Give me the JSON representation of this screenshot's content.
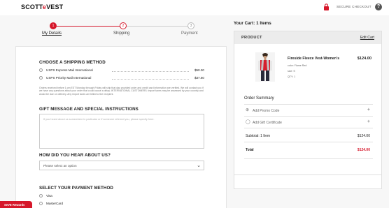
{
  "header": {
    "logo_main": "SCOTT",
    "logo_mid": "e",
    "logo_tail": "VEST",
    "secure_label": "SECURE CHECKOUT",
    "help_label": "?"
  },
  "steps": [
    {
      "num": "1",
      "label": "My Details"
    },
    {
      "num": "2",
      "label": "Shipping"
    },
    {
      "num": "3",
      "label": "Payment"
    }
  ],
  "shipping": {
    "title": "CHOOSE A SHIPPING METHOD",
    "options": [
      {
        "label": "USPS Express Mail International",
        "price": "$50.30"
      },
      {
        "label": "USPS Priority Mail International",
        "price": "$37.60"
      }
    ],
    "note": "Orders received before 1 pm EST Monday through Friday will ship that day provided order and credit card information are verified. We will contact you if we have any questions about your order that could cause a delay. INTERNATIONAL CUSTOMERS: Import taxes may be assessed by your country and would be due on delivery. Any import taxes are billed to the recipient."
  },
  "gift": {
    "title": "GIFT MESSAGE AND SPECIAL INSTRUCTIONS",
    "placeholder": "If you heard about us somewhere in particular or if someone referred you, please specify here."
  },
  "hear": {
    "title": "HOW DID YOU HEAR ABOUT US?",
    "selected": "Please select an option"
  },
  "payment": {
    "title": "SELECT YOUR PAYMENT METHOD",
    "options": [
      "Visa",
      "MasterCard"
    ]
  },
  "feedback": {
    "label": "SeVE Rewards"
  },
  "cart": {
    "title": "Your Cart: 1 Items",
    "head_product": "PRODUCT",
    "head_edit": "Edit Cart",
    "item": {
      "name": "Fireside Fleece Vest-Women's",
      "price": "$124.00",
      "color": "color: Flame Red",
      "size": "size: S",
      "qty": "QTY: 1"
    },
    "summary_title": "Order Summary",
    "promo": "Add Promo Code",
    "gift_cert": "Add Gift Certificate",
    "subtotal_label": "Subtotal: 1 Item",
    "subtotal_value": "$124.00",
    "total_label": "Total",
    "total_value": "$124.00"
  },
  "colors": {
    "accent": "#d6172a",
    "step_inactive": "#cccccc"
  }
}
